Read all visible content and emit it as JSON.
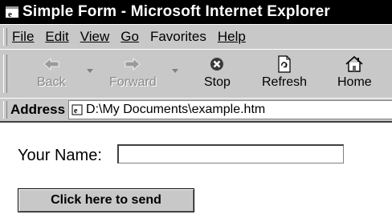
{
  "window": {
    "title": "Simple Form - Microsoft Internet Explorer"
  },
  "menu": {
    "items": [
      "File",
      "Edit",
      "View",
      "Go",
      "Favorites",
      "Help"
    ]
  },
  "toolbar": {
    "back_label": "Back",
    "forward_label": "Forward",
    "stop_label": "Stop",
    "refresh_label": "Refresh",
    "home_label": "Home",
    "icons": [
      "back-arrow-icon",
      "forward-arrow-icon",
      "stop-icon",
      "refresh-icon",
      "home-icon"
    ]
  },
  "address": {
    "label": "Address",
    "value": "D:\\My Documents\\example.htm"
  },
  "form": {
    "name_label": "Your Name:",
    "name_value": "",
    "submit_label": "Click here to send"
  }
}
